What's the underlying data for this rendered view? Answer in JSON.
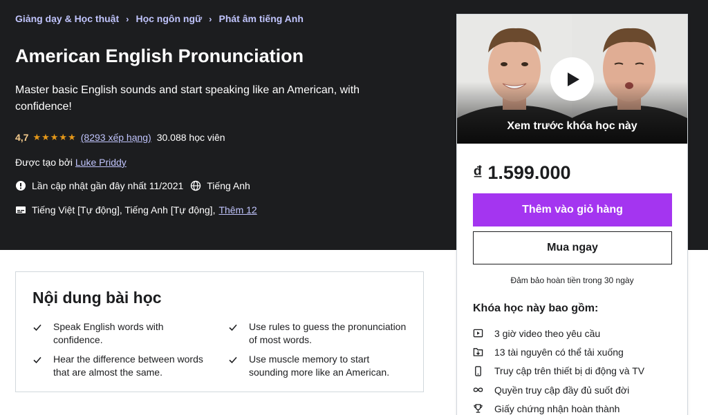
{
  "breadcrumb": [
    "Giảng dạy & Học thuật",
    "Học ngôn ngữ",
    "Phát âm tiếng Anh"
  ],
  "course": {
    "title": "American English Pronunciation",
    "subtitle": "Master basic English sounds and start speaking like an American, with confidence!",
    "rating": "4,7",
    "rating_count": "(8293 xếp hạng)",
    "students": "30.088 học viên",
    "created_by_label": "Được tạo bởi",
    "instructor": "Luke Priddy",
    "last_updated": "Lần cập nhật gần đây nhất 11/2021",
    "language": "Tiếng Anh",
    "captions": "Tiếng Việt [Tự động], Tiếng Anh [Tự động],",
    "captions_more": "Thêm 12"
  },
  "sidebar": {
    "preview_label": "Xem trước khóa học này",
    "price": "₫ 1.599.000",
    "add_to_cart": "Thêm vào giỏ hàng",
    "buy_now": "Mua ngay",
    "guarantee": "Đảm bảo hoàn tiền trong 30 ngày",
    "includes_title": "Khóa học này bao gồm:",
    "includes": [
      {
        "icon": "video-icon",
        "label": "3 giờ video theo yêu cầu"
      },
      {
        "icon": "download-icon",
        "label": "13 tài nguyên có thể tải xuống"
      },
      {
        "icon": "mobile-icon",
        "label": "Truy cập trên thiết bị di động và TV"
      },
      {
        "icon": "infinity-icon",
        "label": "Quyền truy cập đầy đủ suốt đời"
      },
      {
        "icon": "trophy-icon",
        "label": "Giấy chứng nhận hoàn thành"
      }
    ]
  },
  "learn": {
    "title": "Nội dung bài học",
    "items": [
      "Speak English words with confidence.",
      "Use rules to guess the pronunciation of most words.",
      "Hear the difference between words that are almost the same.",
      "Use muscle memory to start sounding more like an American."
    ]
  },
  "colors": {
    "hero_bg": "#1c1d1f",
    "accent_purple": "#a435f0",
    "link_light": "#c0c4fc",
    "star": "#e59819"
  }
}
